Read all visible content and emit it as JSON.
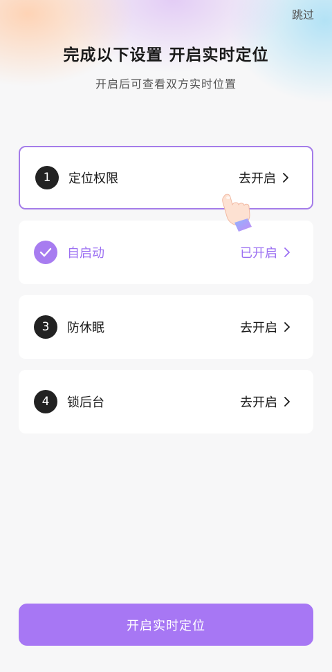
{
  "header": {
    "skip_label": "跳过",
    "title": "完成以下设置 开启实时定位",
    "subtitle": "开启后可查看双方实时位置"
  },
  "steps": [
    {
      "badge": "1",
      "label": "定位权限",
      "action": "去开启",
      "status": "pending",
      "highlighted": true
    },
    {
      "badge": "check-icon",
      "label": "自启动",
      "action": "已开启",
      "status": "done",
      "highlighted": false
    },
    {
      "badge": "3",
      "label": "防休眠",
      "action": "去开启",
      "status": "pending",
      "highlighted": false
    },
    {
      "badge": "4",
      "label": "锁后台",
      "action": "去开启",
      "status": "pending",
      "highlighted": false
    }
  ],
  "cta": {
    "label": "开启实时定位"
  },
  "colors": {
    "accent": "#a777f4",
    "done_text": "#9b6ff2",
    "badge_dark": "#222222",
    "highlight_border": "#a47ce9"
  },
  "icons": {
    "chevron": "chevron-right-icon",
    "check": "check-icon",
    "pointer": "pointing-hand-icon"
  }
}
